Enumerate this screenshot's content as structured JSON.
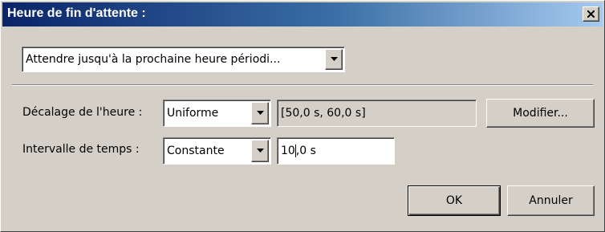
{
  "window": {
    "title": "Heure de fin d'attente :"
  },
  "mode_select": {
    "value": "Attendre jusqu'à la prochaine heure périodi..."
  },
  "time_offset": {
    "label": "Décalage de l'heure :",
    "distribution": "Uniforme",
    "range": "[50,0 s, 60,0 s]",
    "modify_label": "Modifier..."
  },
  "time_interval": {
    "label": "Intervalle de temps :",
    "distribution": "Constante",
    "value_before_caret": "10",
    "value_after_caret": ",0 s"
  },
  "footer": {
    "ok_label": "OK",
    "cancel_label": "Annuler"
  },
  "icons": {
    "close": "close-icon",
    "dropdown": "chevron-down-icon"
  },
  "colors": {
    "title_gradient_start": "#0a246a",
    "title_gradient_end": "#a6caf0",
    "face": "#d4d0c8"
  }
}
